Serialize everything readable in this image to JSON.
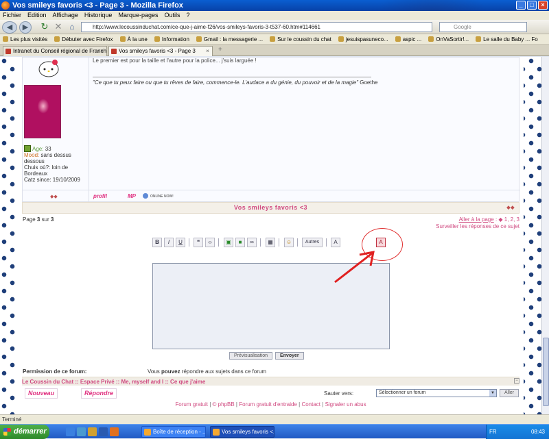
{
  "window": {
    "title": "Vos smileys favoris <3 - Page 3 - Mozilla Firefox"
  },
  "menu": [
    "Fichier",
    "Edition",
    "Affichage",
    "Historique",
    "Marque-pages",
    "Outils",
    "?"
  ],
  "nav": {
    "url": "http://www.lecoussinduchat.com/ce-que-j-aime-f26/vos-smileys-favoris-3-t537-60.htm#114661",
    "search_placeholder": "Google"
  },
  "bookmarks": [
    "Les plus visités",
    "Débuter avec Firefox",
    "À la une",
    "Information",
    "Gmail : la messagerie ...",
    "Sur le coussin du chat",
    "jesuispasuneco...",
    "aspic ...",
    "OnVaSortir!...",
    "Le salle du Baby ... Fo"
  ],
  "tabs": [
    {
      "label": "Intranet du Conseil régional de Franch..."
    },
    {
      "label": "Vos smileys favoris <3 - Page 3"
    }
  ],
  "post": {
    "text": "Le premier est pour la taille et l'autre pour la police... j'suis larguée !",
    "signature": "\"Ce que tu peux faire ou que tu rêves de faire, commence-le. L'audace a du génie, du pouvoir et de la magie\"",
    "signature_author": " Goethe",
    "profile": {
      "age_label": "Age:",
      "age": " 33",
      "mood_label": "Mood:",
      "mood": " sans dessus dessous",
      "location": "Chuis où?: loin de Bordeaux",
      "since": "Catz since: 19/10/2009"
    },
    "buttons": {
      "profile": "profil",
      "mp": "MP",
      "online": "ONLINE NOW!"
    }
  },
  "topic": {
    "title": "Vos smileys favoris <3"
  },
  "pagination": {
    "page_prefix": "Page ",
    "current": "3",
    "sur": " sur ",
    "total": "3",
    "goto_label": "Aller à la page",
    "goto_pages": " : ◆ 1, 2, 3",
    "watch": "Surveiller les réponses de ce sujet"
  },
  "toolbar": {
    "bold": "B",
    "italic": "I",
    "underline": "U",
    "others": "Autres"
  },
  "editor": {
    "preview": "Prévisualisation",
    "send": "Envoyer"
  },
  "permissions": {
    "label": "Permission de ce forum:",
    "value_pre": "Vous ",
    "value_bold": "pouvez",
    "value_post": " répondre aux sujets dans ce forum"
  },
  "breadcrumb": "Le Coussin du Chat :: Espace Privé :: Me, myself and I :: Ce que j'aime",
  "actions": {
    "new": "Nouveau",
    "reply": "Répondre"
  },
  "jump": {
    "label": "Sauter vers:",
    "selected": "Sélectionner un forum",
    "go": "Aller"
  },
  "footer": {
    "links": [
      "Forum gratuit",
      "© phpBB",
      "Forum gratuit d'entraide",
      "Contact",
      "Signaler un abus"
    ]
  },
  "statusbar": "Terminé",
  "taskbar": {
    "start": "démarrer",
    "tasks": [
      "Boîte de réception - ...",
      "Vos smileys favoris <..."
    ],
    "lang": "FR",
    "clock": "08:43"
  },
  "colors": {
    "accent": "#d04a80",
    "title_bar": "#0842a8",
    "annotation": "#e03030"
  }
}
